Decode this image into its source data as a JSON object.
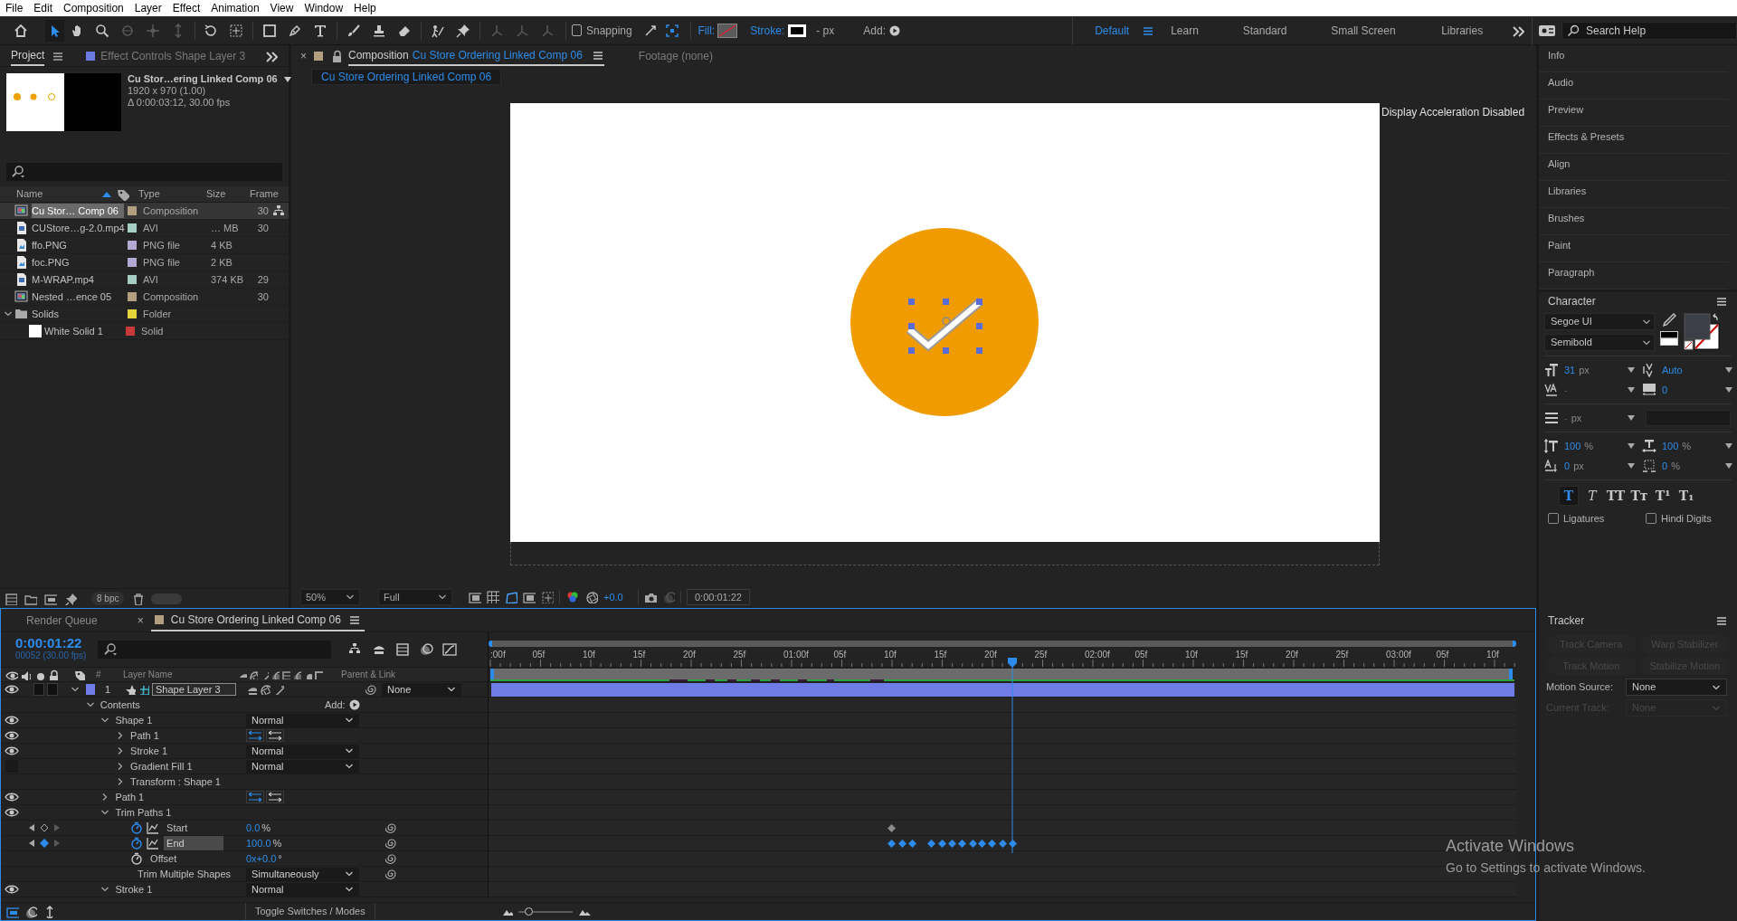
{
  "menu": [
    "File",
    "Edit",
    "Composition",
    "Layer",
    "Effect",
    "Animation",
    "View",
    "Window",
    "Help"
  ],
  "toolbar": {
    "snapping": {
      "label": "Snapping",
      "checked": false
    },
    "fill": "Fill:",
    "stroke": "Stroke:",
    "stroke_width": "- px",
    "add": "Add:"
  },
  "workspaces": [
    {
      "label": "Default",
      "selected": true
    },
    {
      "label": "Learn",
      "selected": false
    },
    {
      "label": "Standard",
      "selected": false
    },
    {
      "label": "Small Screen",
      "selected": false
    },
    {
      "label": "Libraries",
      "selected": false
    }
  ],
  "search_help": {
    "placeholder": "Search Help"
  },
  "project": {
    "tabs": [
      {
        "label": "Project",
        "selected": true
      },
      {
        "label": "Effect Controls Shape Layer 3",
        "selected": false,
        "color": "#6b7be0"
      }
    ],
    "preview": {
      "name": "Cu Stor…ering Linked Comp 06",
      "dimensions": "1920 x 970 (1.00)",
      "duration": "Δ 0:00:03:12, 30.00 fps"
    },
    "columns": [
      "Name",
      "Type",
      "Size",
      "Frame"
    ],
    "items": [
      {
        "kind": "composition",
        "name": "Cu Stor… Comp 06",
        "color": "#b19f7f",
        "type": "Composition",
        "frame_rate": "30",
        "selected": true
      },
      {
        "kind": "video",
        "name": "CUStore…g-2.0.mp4",
        "color": "#a6cdc4",
        "type": "AVI",
        "size": "… MB",
        "frame_rate": "30",
        "selected": false
      },
      {
        "kind": "image",
        "name": "ffo.PNG",
        "color": "#b3a9d3",
        "type": "PNG file",
        "size": "4 KB",
        "selected": false
      },
      {
        "kind": "image",
        "name": "foc.PNG",
        "color": "#b3a9d3",
        "type": "PNG file",
        "size": "2 KB",
        "selected": false
      },
      {
        "kind": "video",
        "name": "M-WRAP.mp4",
        "color": "#a6cdc4",
        "type": "AVI",
        "size": "374 KB",
        "frame_rate": "29",
        "selected": false
      },
      {
        "kind": "composition",
        "name": "Nested …ence 05",
        "color": "#b19f7f",
        "type": "Composition",
        "frame_rate": "30",
        "selected": false
      },
      {
        "kind": "folder",
        "name": "Solids",
        "color": "#e3d43a",
        "type": "Folder",
        "expanded": true,
        "selected": false,
        "children": [
          {
            "kind": "solid",
            "name": "White Solid 1",
            "color": "#c83a3a",
            "type": "Solid",
            "selected": false
          }
        ]
      }
    ],
    "bpc": "8 bpc"
  },
  "composition": {
    "tabs": [
      {
        "close": "×",
        "label": "Composition",
        "comp_name": "Cu Store Ordering Linked Comp 06",
        "selected": true,
        "color": "#b19f7f"
      },
      {
        "label": "Footage (none)",
        "selected": false
      }
    ],
    "breadcrumb": "Cu Store Ordering Linked Comp 06",
    "notice": "Display Acceleration Disabled",
    "zoom": "50%",
    "resolution": "Full",
    "exposure": "+0.0",
    "timecode": "0:00:01:22"
  },
  "panels": [
    "Info",
    "Audio",
    "Preview",
    "Effects & Presets",
    "Align",
    "Libraries",
    "Brushes",
    "Paint",
    "Paragraph"
  ],
  "character": {
    "title": "Character",
    "font": "Segoe UI",
    "style": "Semibold",
    "size": {
      "value": "31",
      "unit": "px"
    },
    "leading": {
      "value": "Auto"
    },
    "kerning": {
      "value": "-"
    },
    "tracking": {
      "value": "0"
    },
    "indent": {
      "value": "-",
      "unit": "px"
    },
    "vertical_scale": {
      "value": "100",
      "unit": "%"
    },
    "horizontal_scale": {
      "value": "100",
      "unit": "%"
    },
    "baseline_shift": {
      "value": "0",
      "unit": "px"
    },
    "tsume": {
      "value": "0",
      "unit": "%"
    },
    "styles": [
      {
        "kind": "bold",
        "label": "T",
        "selected": true
      },
      {
        "kind": "italic",
        "label": "T",
        "selected": false
      },
      {
        "kind": "caps",
        "label": "TT",
        "selected": false
      },
      {
        "kind": "small_caps",
        "label": "Tᴛ",
        "selected": false
      },
      {
        "kind": "super",
        "label": "T¹",
        "selected": false
      },
      {
        "kind": "sub",
        "label": "T₁",
        "selected": false
      }
    ],
    "options": [
      {
        "label": "Ligatures",
        "checked": false
      },
      {
        "label": "Hindi Digits",
        "checked": false
      }
    ]
  },
  "timeline": {
    "tabs": [
      {
        "label": "Render Queue",
        "selected": false
      },
      {
        "close": "×",
        "label": "Cu Store Ordering Linked Comp 06",
        "selected": true,
        "color": "#b19f7f"
      }
    ],
    "timecode": "0:00:01:22",
    "frame": "00052 (30.00 fps)",
    "columns": {
      "number": "#",
      "name": "Layer Name",
      "parent": "Parent & Link"
    },
    "ruler": [
      ":00f",
      "05f",
      "10f",
      "15f",
      "20f",
      "25f",
      "01:00f",
      "05f",
      "10f",
      "15f",
      "20f",
      "25f",
      "02:00f",
      "05f",
      "10f",
      "15f",
      "20f",
      "25f",
      "03:00f",
      "05f",
      "10f"
    ],
    "layers": [
      {
        "kind": "layer",
        "number": "1",
        "label": "Shape Layer 3",
        "color": "#6f7be6",
        "visible": true,
        "expanded": true,
        "parent": "None",
        "children": [
          {
            "kind": "group",
            "label": "Contents",
            "expanded": true,
            "add": "Add:",
            "children": [
              {
                "kind": "group",
                "label": "Shape 1",
                "visible": true,
                "expanded": true,
                "mode": "Normal",
                "children": [
                  {
                    "kind": "path",
                    "label": "Path 1",
                    "visible": true,
                    "expanded": false
                  },
                  {
                    "kind": "group",
                    "label": "Stroke 1",
                    "visible": true,
                    "expanded": false,
                    "mode": "Normal"
                  },
                  {
                    "kind": "group",
                    "label": "Gradient Fill 1",
                    "visible": false,
                    "expanded": false,
                    "mode": "Normal"
                  },
                  {
                    "kind": "group",
                    "label": "Transform : Shape 1",
                    "expanded": false
                  }
                ]
              },
              {
                "kind": "path",
                "label": "Path 1",
                "visible": true,
                "expanded": false
              },
              {
                "kind": "group",
                "label": "Trim Paths 1",
                "visible": true,
                "expanded": true,
                "children": [
                  {
                    "kind": "property",
                    "label": "Start",
                    "value": "0.0",
                    "unit": "%",
                    "animated": true,
                    "at_keyframe": false,
                    "selected": false,
                    "keyframes": [
                      {
                        "level": 0.392
                      }
                    ]
                  },
                  {
                    "kind": "property",
                    "label": "End",
                    "value": "100.0",
                    "unit": "%",
                    "animated": true,
                    "at_keyframe": true,
                    "selected": true,
                    "keyframes": [
                      {
                        "level": 0.392
                      },
                      {
                        "level": 0.402
                      },
                      {
                        "level": 0.412
                      },
                      {
                        "level": 0.431
                      },
                      {
                        "level": 0.441
                      },
                      {
                        "level": 0.451
                      },
                      {
                        "level": 0.461
                      },
                      {
                        "level": 0.471
                      },
                      {
                        "level": 0.48
                      },
                      {
                        "level": 0.49
                      },
                      {
                        "level": 0.5
                      },
                      {
                        "level": 0.51
                      }
                    ]
                  },
                  {
                    "kind": "property",
                    "label": "Offset",
                    "value": "0x+0.0",
                    "unit": "°",
                    "animated": false,
                    "selected": false
                  },
                  {
                    "kind": "option",
                    "label": "Trim Multiple Shapes",
                    "mode": "Simultaneously",
                    "selected": false
                  }
                ]
              },
              {
                "kind": "group",
                "label": "Stroke 1",
                "visible": true,
                "expanded": true,
                "mode": "Normal"
              }
            ]
          }
        ]
      }
    ],
    "zoom": {
      "level": 0.15
    },
    "footer": "Toggle Switches / Modes"
  },
  "tracker": {
    "title": "Tracker",
    "buttons": [
      {
        "label": "Track Camera",
        "disabled": true
      },
      {
        "label": "Warp Stabilizer",
        "disabled": true
      },
      {
        "label": "Track Motion",
        "disabled": true
      },
      {
        "label": "Stabilize Motion",
        "disabled": true
      }
    ],
    "fields": [
      {
        "label": "Motion Source:",
        "value": "None",
        "disabled": false
      },
      {
        "label": "Current Track:",
        "value": "None",
        "disabled": true
      }
    ]
  },
  "activation": {
    "title": "Activate Windows",
    "text": "Go to Settings to activate Windows."
  }
}
